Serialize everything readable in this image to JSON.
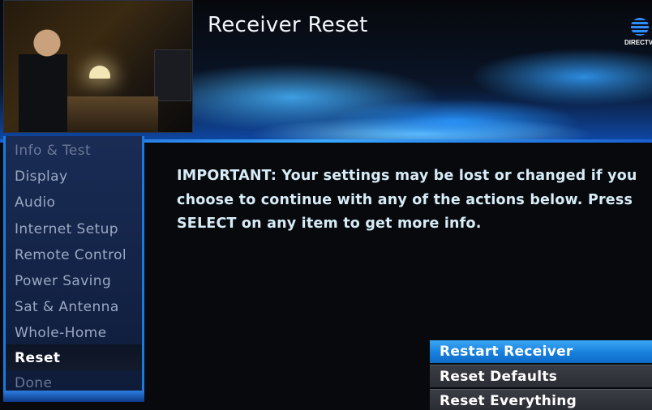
{
  "header": {
    "title": "Receiver Reset",
    "brand": "DIRECTV"
  },
  "sidebar": {
    "items": [
      {
        "label": "Info & Test"
      },
      {
        "label": "Display"
      },
      {
        "label": "Audio"
      },
      {
        "label": "Internet Setup"
      },
      {
        "label": "Remote Control"
      },
      {
        "label": "Power Saving"
      },
      {
        "label": "Sat & Antenna"
      },
      {
        "label": "Whole-Home"
      },
      {
        "label": "Reset",
        "selected": true
      },
      {
        "label": "Done"
      }
    ]
  },
  "main": {
    "message": "IMPORTANT: Your settings may be lost or changed if you choose to continue with any of the actions below. Press SELECT on any item to get more info."
  },
  "options": [
    {
      "label": "Restart Receiver",
      "highlighted": true
    },
    {
      "label": "Reset Defaults"
    },
    {
      "label": "Reset Everything"
    }
  ],
  "colors": {
    "accent": "#1a7ae0",
    "highlight": "#2a92ea",
    "text": "#d7ecf6"
  }
}
